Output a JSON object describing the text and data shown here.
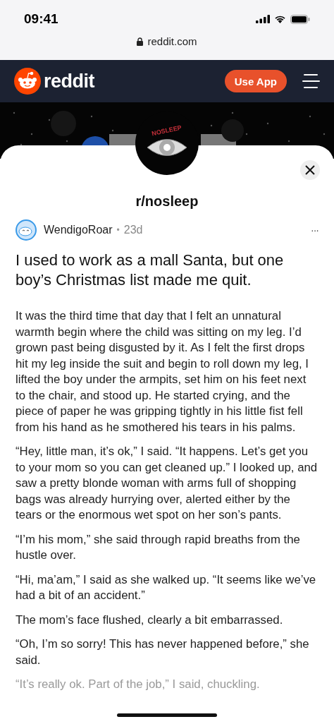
{
  "status_bar": {
    "time": "09:41"
  },
  "browser": {
    "url": "reddit.com"
  },
  "nav": {
    "logo_text": "reddit",
    "button": "Use App"
  },
  "community": {
    "name": "r/nosleep",
    "banner_text": "NOSLEEP"
  },
  "post": {
    "author": "WendigoRoar",
    "separator": "•",
    "age": "23d",
    "more": "···",
    "title": "I used to work as a mall Santa, but one boy’s Christmas list made me quit.",
    "paragraphs": [
      {
        "text": "It was the third time that day that I felt an unnatural warmth begin where the child was sitting on my leg. I’d grown past being disgusted by it. As I felt the first drops hit my leg inside the suit and begin to roll down my leg, I lifted the boy under the armpits, set him on his feet next to the chair, and stood up. He started crying, and the piece of paper he was gripping tightly in his little fist fell from his hand as he smothered his tears in his palms.",
        "faded": false
      },
      {
        "text": "“Hey, little man, it’s ok,” I said. “It happens. Let’s get you to your mom so you can get cleaned up.” I looked up, and saw a pretty blonde woman with arms full of shopping bags was already hurrying over, alerted either by the tears or the enormous wet spot on her son’s pants.",
        "faded": false
      },
      {
        "text": "“I’m his mom,” she said through rapid breaths from the hustle over.",
        "faded": false
      },
      {
        "text": "“Hi, ma’am,” I said as she walked up. “It seems like we’ve had a bit of an accident.”",
        "faded": false
      },
      {
        "text": "The mom’s face flushed, clearly a bit embarrassed.",
        "faded": false
      },
      {
        "text": "“Oh, I’m so sorry! This has never happened before,” she said.",
        "faded": false
      },
      {
        "text": "“It’s really ok. Part of the job,” I said, chuckling.",
        "faded": true
      }
    ]
  }
}
